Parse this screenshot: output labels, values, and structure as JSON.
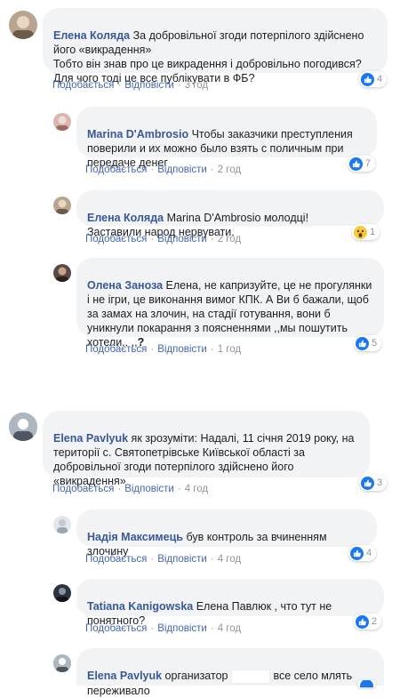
{
  "comments": [
    {
      "author": "Елена Коляда",
      "text_1": " За добровільної згоди потерпілого здійснено його «викрадення»\nТобто він знав про це викрадення і добровільно погодився?\nДля чого тоді це все публікувати в ФБ?",
      "like_label": "Подобається",
      "reply_label": "Відповісти",
      "time": "3 год",
      "reaction_count": "4",
      "reaction_icon": "like-icon"
    },
    {
      "author": "Marina D'Ambrosio",
      "text_1": " Чтобы заказчики преступления поверили и их можно было взять с поличным при передаче денег",
      "like_label": "Подобається",
      "reply_label": "Відповісти",
      "time": "2 год",
      "reaction_count": "7",
      "reaction_icon": "like-icon"
    },
    {
      "author": "Елена Коляда",
      "text_1": " Marina D'Ambrosio молодці!\nЗаставили народ нервувати.",
      "like_label": "Подобається",
      "reply_label": "Відповісти",
      "time": "2 год",
      "reaction_count": "1",
      "reaction_icon": "wow-icon"
    },
    {
      "author": "Олена Заноза",
      "text_1": " Елена, не капризуйте, це не прогулянки і не ігри, це виконання вимог КПК. А Ви б бажали, щоб за замах на злочин, на стадії готування, вони б уникнули покарання з поясненнями ,,мы пошутить хотели.. ,,",
      "text_2": "?",
      "like_label": "Подобається",
      "reply_label": "Відповісти",
      "time": "1 год",
      "reaction_count": "5",
      "reaction_icon": "like-icon"
    },
    {
      "author": "Elena Pavlyuk",
      "text_1": " як зрозуміти: Надалі, 11 січня 2019 року, на території с. Святопетрівське Київської області за добровільної згоди потерпілого здійснено його «викрадення»",
      "like_label": "Подобається",
      "reply_label": "Відповісти",
      "time": "4 год",
      "reaction_count": "3",
      "reaction_icon": "like-icon"
    },
    {
      "author": "Надія Максимець",
      "text_1": " був контроль за вчиненням злочину",
      "like_label": "Подобається",
      "reply_label": "Відповісти",
      "time": "4 год",
      "reaction_count": "4",
      "reaction_icon": "like-icon"
    },
    {
      "author": "Tatiana Kanigowska",
      "text_1": " Елена Павлюк , что тут не понятного?",
      "like_label": "Подобається",
      "reply_label": "Відповісти",
      "time": "4 год",
      "reaction_count": "2",
      "reaction_icon": "like-icon"
    },
    {
      "author": "Elena Pavlyuk",
      "text_1": " организатор",
      "text_2": " все село млять переживало",
      "reaction_icon": "like-icon"
    }
  ],
  "colors": {
    "author": "#385898",
    "bubble": "#f2f3f5",
    "meta": "#90949c",
    "like": "#1877f2",
    "wow": "#f7c93b"
  }
}
